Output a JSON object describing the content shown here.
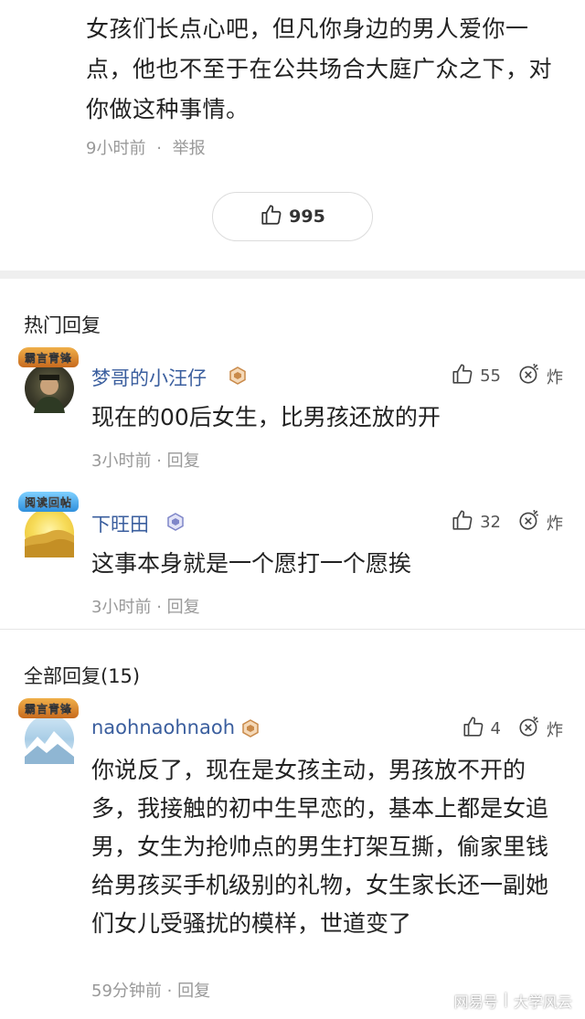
{
  "top_comment": {
    "text": "女孩们长点心吧，但凡你身边的男人爱你一点，他也不至于在公共场合大庭广众之下，对你做这种事情。",
    "time": "9小时前",
    "separator": "·",
    "report_label": "举报",
    "like_count": "995"
  },
  "hot_replies": {
    "title": "热门回复",
    "items": [
      {
        "username": "梦哥的小汪仔",
        "avatar_badge": "霸言青锋",
        "text": "现在的00后女生，比男孩还放的开",
        "time": "3小时前",
        "reply_label": "回复",
        "likes": "55",
        "bomb_label": "炸"
      },
      {
        "username": "下旺田",
        "avatar_badge": "阅读回帖",
        "text": "这事本身就是一个愿打一个愿挨",
        "time": "3小时前",
        "reply_label": "回复",
        "likes": "32",
        "bomb_label": "炸"
      }
    ]
  },
  "all_replies": {
    "title": "全部回复(15)",
    "items": [
      {
        "username": "naohnaohnaoh",
        "avatar_badge": "霸言青锋",
        "text": "你说反了，现在是女孩主动，男孩放不开的多，我接触的初中生早恋的，基本上都是女追男，女生为抢帅点的男生打架互撕，偷家里钱给男孩买手机级别的礼物，女生家长还一副她们女儿受骚扰的模样，世道变了",
        "time": "59分钟前",
        "reply_label": "回复",
        "likes": "4",
        "bomb_label": "炸"
      }
    ]
  },
  "watermark": {
    "left": "网易号",
    "sep": "|",
    "right": "大学风云"
  },
  "colors": {
    "username": "#3a5e9e",
    "meta": "#999999",
    "divider": "#efefef"
  }
}
